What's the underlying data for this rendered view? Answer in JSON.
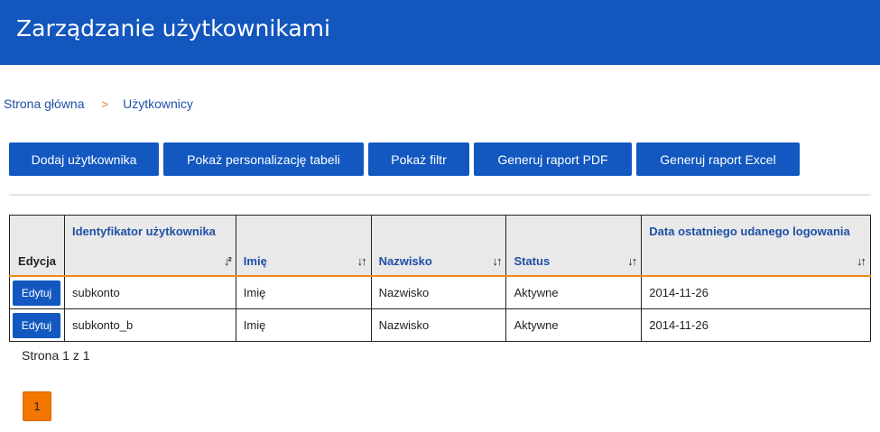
{
  "header": {
    "title": "Zarządzanie użytkownikami"
  },
  "breadcrumb": {
    "home": "Strona główna",
    "separator": ">",
    "current": "Użytkownicy"
  },
  "toolbar": {
    "add_user": "Dodaj użytkownika",
    "show_personalization": "Pokaż personalizację tabeli",
    "show_filter": "Pokaż filtr",
    "pdf_report": "Generuj raport PDF",
    "excel_report": "Generuj raport Excel"
  },
  "table": {
    "columns": [
      "Edycja",
      "Identyfikator użytkownika",
      "Imię",
      "Nazwisko",
      "Status",
      "Data ostatniego udanego logowania"
    ],
    "edit_label": "Edytuj",
    "rows": [
      {
        "id": "subkonto",
        "first_name": "Imię",
        "last_name": "Nazwisko",
        "status": "Aktywne",
        "last_login": "2014-11-26"
      },
      {
        "id": "subkonto_b",
        "first_name": "Imię",
        "last_name": "Nazwisko",
        "status": "Aktywne",
        "last_login": "2014-11-26"
      }
    ]
  },
  "pagination": {
    "info": "Strona 1 z 1",
    "current_page": "1"
  },
  "colors": {
    "brand": "#1356bd",
    "accent": "#f37600"
  }
}
